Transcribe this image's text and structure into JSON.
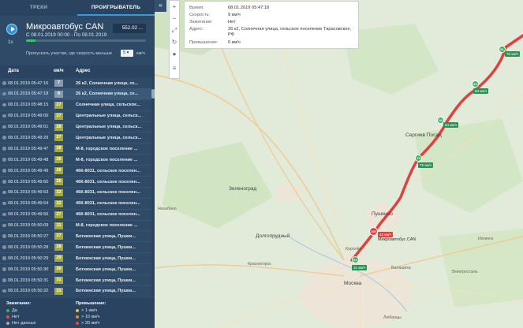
{
  "tabs": [
    {
      "label": "ТРЕКИ"
    },
    {
      "label": "ПРОИГРЫВАТЕЛЬ"
    }
  ],
  "vehicle": {
    "name": "Микроавтобус CAN",
    "dates": "С 08.01.2019 00:00 - По 08.01.2019",
    "distance": "552.02 ...",
    "speed_multiplier": "1x",
    "progress": 0.08
  },
  "skip": {
    "label": "Пропускать участки, где скорость меньше",
    "value": "5",
    "unit": "км/ч"
  },
  "table": {
    "headers": {
      "date": "Дата",
      "speed": "км/ч",
      "address": "Адрес"
    },
    "rows": [
      {
        "date": "08.01.2019 05:47:16",
        "speed": "7",
        "address": "26 к2, Солнечная улица, се..."
      },
      {
        "date": "08.01.2019 05:47:18",
        "speed": "9",
        "address": "26 к2, Солнечная улица, се..."
      },
      {
        "date": "08.01.2019 05:48:15",
        "speed": "27",
        "address": "Солнечная улица, сельское..."
      },
      {
        "date": "08.01.2019 05:49:00",
        "speed": "27",
        "address": "Центральные улица, сельск..."
      },
      {
        "date": "08.01.2019 05:49:01",
        "speed": "28",
        "address": "Центральные улица, сельск..."
      },
      {
        "date": "08.01.2019 05:49:29",
        "speed": "27",
        "address": "Центральные улица, сельск..."
      },
      {
        "date": "08.01.2019 05:49:47",
        "speed": "28",
        "address": "М-8, городское поселение ..."
      },
      {
        "date": "08.01.2019 05:49:48",
        "speed": "26",
        "address": "М-8, городское поселение ..."
      },
      {
        "date": "08.01.2019 05:49:49",
        "speed": "26",
        "address": "46К-8031, сельское поселен..."
      },
      {
        "date": "08.01.2019 05:49:50",
        "speed": "25",
        "address": "46К-8031, сельское поселен..."
      },
      {
        "date": "08.01.2019 05:49:53",
        "speed": "22",
        "address": "46К-8031, сельское поселен..."
      },
      {
        "date": "08.01.2019 05:49:54",
        "speed": "22",
        "address": "46К-8031, сельское поселен..."
      },
      {
        "date": "08.01.2019 05:49:56",
        "speed": "27",
        "address": "46К-8031, сельское поселен..."
      },
      {
        "date": "08.01.2019 05:50:09",
        "speed": "11",
        "address": "М-8, городское поселение ..."
      },
      {
        "date": "08.01.2019 05:50:27",
        "speed": "27",
        "address": "Боткинская улица, Пушки..."
      },
      {
        "date": "08.01.2019 05:50:28",
        "speed": "28",
        "address": "Боткинская улица, Пушки..."
      },
      {
        "date": "08.01.2019 05:50:29",
        "speed": "29",
        "address": "Боткинская улица, Пушки..."
      },
      {
        "date": "08.01.2019 05:50:30",
        "speed": "30",
        "address": "Боткинская улица, Пушки..."
      },
      {
        "date": "08.01.2019 05:50:31",
        "speed": "31",
        "address": "Боткинская улица, Пушки..."
      },
      {
        "date": "08.01.2019 05:50:32",
        "speed": "31",
        "address": "Боткинская улица, Пушки..."
      }
    ]
  },
  "legend": {
    "ignition_title": "Зажигание:",
    "ignition": [
      {
        "label": "Да",
        "color": "#3bb05d"
      },
      {
        "label": "Нет",
        "color": "#e04b4b"
      },
      {
        "label": "Нет данных",
        "color": "#9aa7b4"
      }
    ],
    "excess_title": "Превышение:",
    "excess": [
      {
        "label": "> 1 км/ч",
        "color": "#e0c24b"
      },
      {
        "label": "> 10 км/ч",
        "color": "#e08a3b"
      },
      {
        "label": "> 20 км/ч",
        "color": "#e04b4b"
      }
    ]
  },
  "tooltip": {
    "time_label": "Время:",
    "time": "08.01.2019 05:47:18",
    "speed_label": "Скорость:",
    "speed": "9 км/ч",
    "ignition_label": "Зажигание:",
    "ignition": "Нет",
    "address_label": "Адрес:",
    "address": "26 к2, Солнечная улица, сельское поселение Тарасовское, РФ",
    "excess_label": "Превышение:",
    "excess": "0 км/ч"
  },
  "map": {
    "places": [
      {
        "name": "Нахабино"
      },
      {
        "name": "Зеленоград"
      },
      {
        "name": "Долгопрудный"
      },
      {
        "name": "Красногорск"
      },
      {
        "name": "Москва"
      },
      {
        "name": "Пушкино"
      },
      {
        "name": "Королёв"
      },
      {
        "name": "Балашиха"
      },
      {
        "name": "Люберцы"
      },
      {
        "name": "Сергиев Посад"
      },
      {
        "name": "Электросталь"
      },
      {
        "name": "Ногинск"
      }
    ],
    "markers": [
      {
        "label": "61",
        "speed": "70 км/ч"
      },
      {
        "label": "63",
        "speed": "63 км/ч"
      },
      {
        "label": "58",
        "speed": "64 км/ч"
      },
      {
        "label": "78",
        "speed": "75 км/ч"
      },
      {
        "label": "61",
        "speed": "31 км/ч"
      }
    ],
    "vehicle_label": "Микроавтобус CAN",
    "vehicle_badge": "100",
    "vehicle_speed": "42 км/ч"
  }
}
